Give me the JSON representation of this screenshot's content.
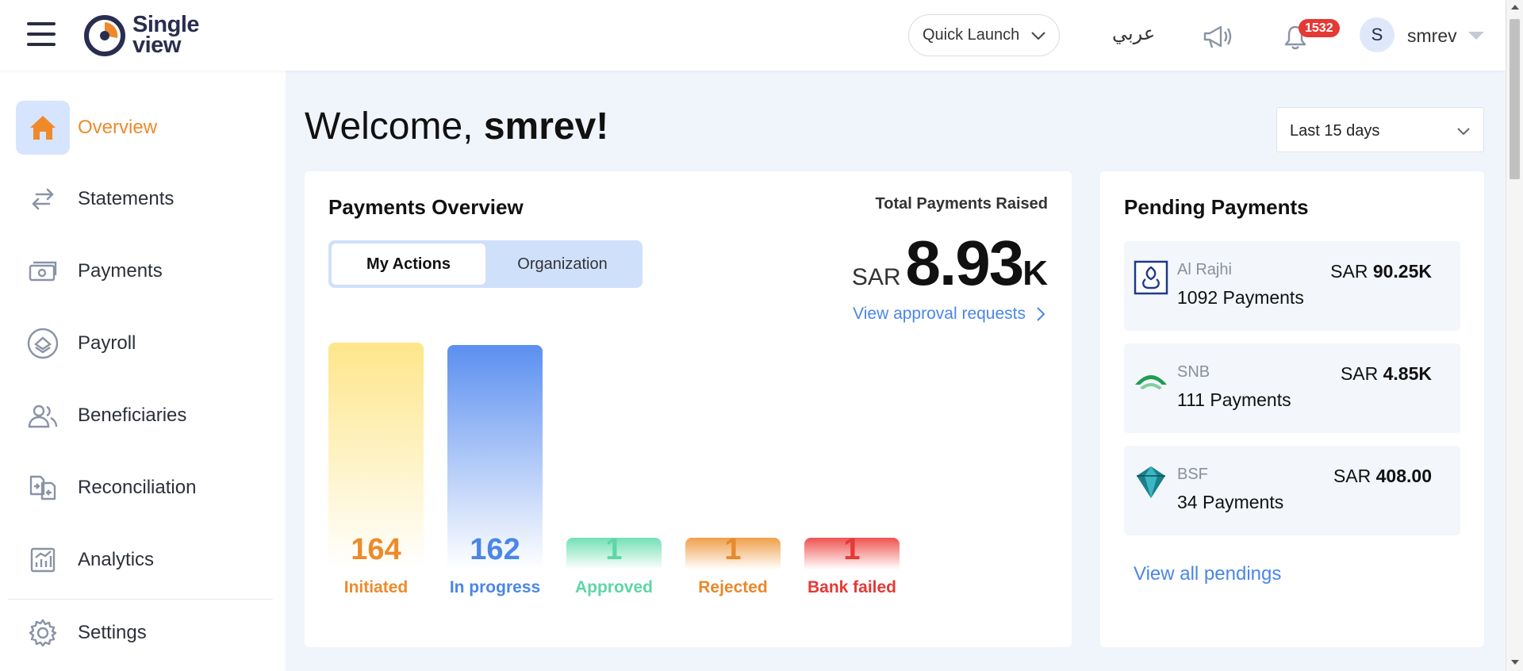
{
  "header": {
    "logo_line1": "Single",
    "logo_line2": "view",
    "quick_launch": "Quick Launch",
    "language": "عربي",
    "notification_count": "1532",
    "avatar_initial": "S",
    "username": "smrev"
  },
  "sidebar": {
    "items": [
      {
        "label": "Overview",
        "icon": "home-icon",
        "active": true
      },
      {
        "label": "Statements",
        "icon": "transfer-arrows-icon"
      },
      {
        "label": "Payments",
        "icon": "cash-icon"
      },
      {
        "label": "Payroll",
        "icon": "payroll-icon"
      },
      {
        "label": "Beneficiaries",
        "icon": "people-icon"
      },
      {
        "label": "Reconciliation",
        "icon": "reconciliation-icon"
      },
      {
        "label": "Analytics",
        "icon": "analytics-icon"
      },
      {
        "label": "Settings",
        "icon": "gear-icon"
      }
    ]
  },
  "main": {
    "welcome_prefix": "Welcome, ",
    "welcome_name": "smrev!",
    "date_range": "Last 15 days"
  },
  "payments_overview": {
    "title": "Payments Overview",
    "tabs": [
      "My Actions",
      "Organization"
    ],
    "selected_tab": "My Actions",
    "total_label": "Total Payments Raised",
    "total_currency": "SAR",
    "total_value": "8.93",
    "total_unit": "K",
    "view_approval": "View approval requests",
    "colors": {
      "initiated": "#ee8a2a",
      "in_progress": "#4a86e8",
      "approved": "#5ed6a6",
      "rejected": "#e8892a",
      "bank_failed": "#e53935"
    }
  },
  "chart_data": {
    "type": "bar",
    "categories": [
      "Initiated",
      "In progress",
      "Approved",
      "Rejected",
      "Bank failed"
    ],
    "values": [
      164,
      162,
      1,
      1,
      1
    ]
  },
  "pending": {
    "title": "Pending Payments",
    "items": [
      {
        "bank": "Al Rajhi",
        "count": "1092 Payments",
        "currency": "SAR",
        "amount": "90.25K"
      },
      {
        "bank": "SNB",
        "count": "111 Payments",
        "currency": "SAR",
        "amount": "4.85K"
      },
      {
        "bank": "BSF",
        "count": "34 Payments",
        "currency": "SAR",
        "amount": "408.00"
      }
    ],
    "view_all": "View all pendings"
  }
}
